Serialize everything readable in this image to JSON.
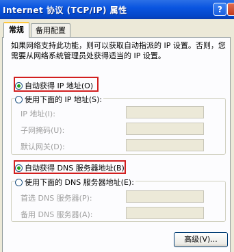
{
  "window": {
    "title": "Internet 协议 (TCP/IP) 属性",
    "help_glyph": "?"
  },
  "tabs": [
    {
      "label": "常规",
      "active": true
    },
    {
      "label": "备用配置",
      "active": false
    }
  ],
  "description": "如果网络支持此功能，则可以获取自动指派的 IP 设置。否则，您需要从网络系统管理员处获得适当的 IP 设置。",
  "ip": {
    "auto_label": "自动获得 IP 地址(O)",
    "manual_label": "使用下面的 IP 地址(S):",
    "fields": [
      {
        "label": "IP 地址(I):",
        "value": ""
      },
      {
        "label": "子网掩码(U):",
        "value": ""
      },
      {
        "label": "默认网关(D):",
        "value": ""
      }
    ]
  },
  "dns": {
    "auto_label": "自动获得 DNS 服务器地址(B)",
    "manual_label": "使用下面的 DNS 服务器地址(E):",
    "fields": [
      {
        "label": "首选 DNS 服务器(P):",
        "value": ""
      },
      {
        "label": "备用 DNS 服务器(A):",
        "value": ""
      }
    ]
  },
  "buttons": {
    "advanced": "高级(V)..."
  },
  "colors": {
    "title_bar": "#0a55e0",
    "highlight_box": "#d21f1f",
    "dialog_bg": "#ece9d8"
  }
}
